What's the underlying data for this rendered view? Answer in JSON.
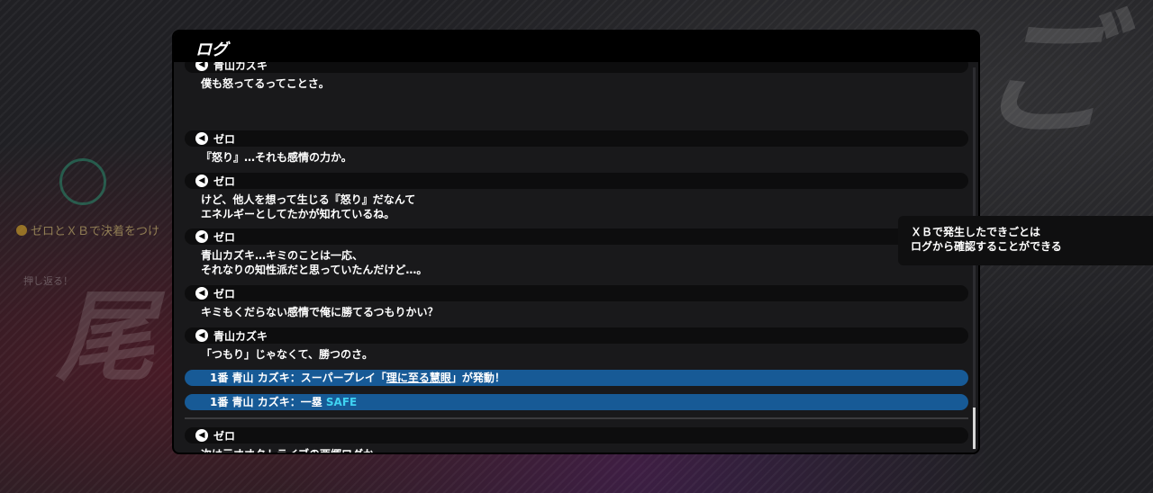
{
  "log": {
    "title": "ログ",
    "entries": [
      {
        "speaker": "青山カズキ",
        "text": "僕も怒ってるってことさ。"
      },
      {
        "speaker": "ゼロ",
        "text": "『怒り』…それも感情の力か。"
      },
      {
        "speaker": "ゼロ",
        "text": "けど、他人を想って生じる『怒り』だなんて\nエネルギーとしてたかが知れているね。"
      },
      {
        "speaker": "ゼロ",
        "text": "青山カズキ…キミのことは一応、\nそれなりの知性派だと思っていたんだけど…。"
      },
      {
        "speaker": "ゼロ",
        "text": "キミもくだらない感情で俺に勝てるつもりかい？"
      },
      {
        "speaker": "青山カズキ",
        "text": "「つもり」じゃなくて、勝つのさ。"
      }
    ],
    "system_events": [
      {
        "prefix": "1番 青山 カズキ：スーパープレイ「",
        "highlight": "理に至る慧眼",
        "suffix": "」が発動！"
      },
      {
        "prefix": "1番 青山 カズキ：一塁 ",
        "result": "SAFE"
      }
    ],
    "latest_entry": {
      "speaker": "ゼロ",
      "text": "次は元オオタトライブの西郷ログか…\nまさかキミまで感情的にはならないよね？"
    }
  },
  "tooltip": {
    "line1": "ＸＢで発生したできごとは",
    "line2": "ログから確認することができる"
  },
  "background": {
    "hint": "ゼロとＸＢで決着をつけ",
    "hint2": "押し返る！"
  },
  "colors": {
    "panel": "#19191b",
    "speaker_bar": "#0d0d0e",
    "system_bar": "#175a96",
    "safe": "#3fd3f2"
  }
}
